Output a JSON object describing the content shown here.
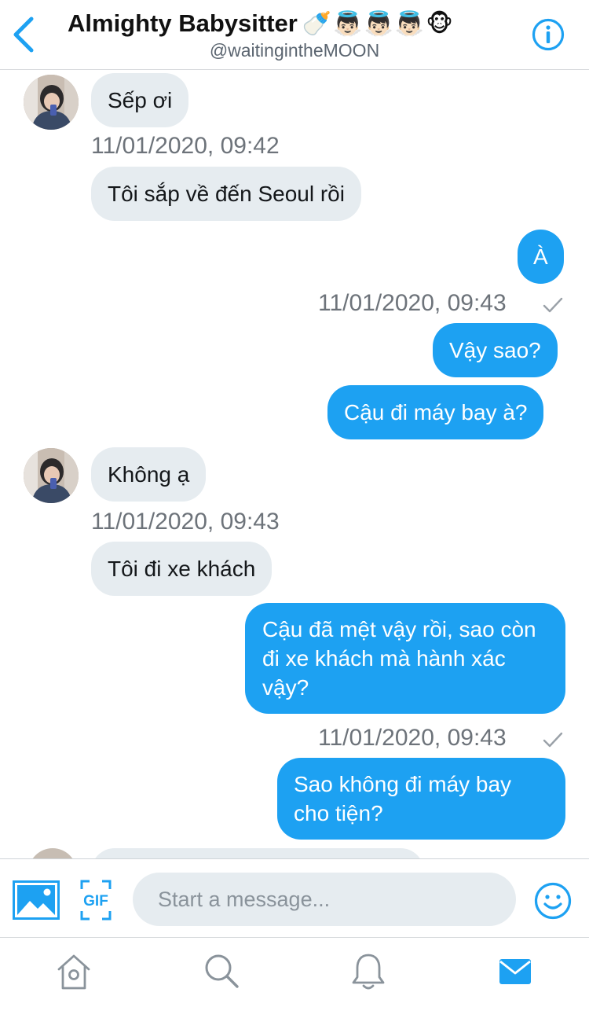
{
  "header": {
    "title": "Almighty Babysitter",
    "title_emoji": "🍼👼🏻👼🏻👼🏻🐵",
    "handle": "@waitingintheMOON",
    "back_icon": "chevron-left-icon",
    "info_icon": "info-icon"
  },
  "colors": {
    "accent": "#1da1f2",
    "incoming_bubble": "#e6ecf0",
    "timestamp": "#6d737a"
  },
  "messages": [
    {
      "direction": "incoming",
      "text": "Sếp ơi"
    },
    {
      "direction": "incoming",
      "text": "Tôi sắp về đến Seoul rồi",
      "timestamp": "11/01/2020, 09:42"
    },
    {
      "direction": "outgoing",
      "text": "À"
    },
    {
      "direction": "outgoing",
      "text": "Vậy sao?",
      "timestamp": "11/01/2020, 09:43",
      "read_icon": "check-icon"
    },
    {
      "direction": "outgoing",
      "text": "Cậu đi máy bay à?"
    },
    {
      "direction": "incoming",
      "text": "Không ạ"
    },
    {
      "direction": "incoming",
      "text": "Tôi đi xe khách",
      "timestamp": "11/01/2020, 09:43"
    },
    {
      "direction": "outgoing",
      "text": "Cậu đã mệt vậy rồi, sao còn đi xe khách mà hành xác vậy?"
    },
    {
      "direction": "outgoing",
      "text": "Sao không đi máy bay cho tiện?",
      "timestamp": "11/01/2020, 09:43",
      "read_icon": "check-icon"
    }
  ],
  "composer": {
    "placeholder": "Start a message...",
    "value": "",
    "gif_label": "GIF",
    "media_icon": "image-icon",
    "emoji_icon": "smiley-icon"
  },
  "tabs": [
    {
      "name": "home",
      "icon": "home-icon",
      "active": false
    },
    {
      "name": "search",
      "icon": "search-icon",
      "active": false
    },
    {
      "name": "notifications",
      "icon": "bell-icon",
      "active": false
    },
    {
      "name": "messages",
      "icon": "mail-icon",
      "active": true
    }
  ]
}
